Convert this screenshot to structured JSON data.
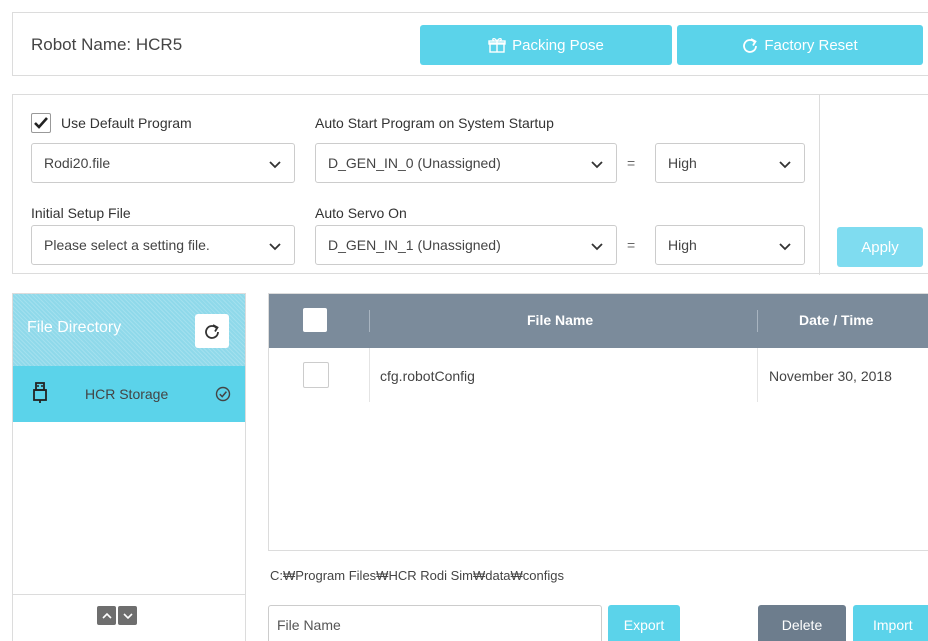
{
  "header": {
    "robot_name_label": "Robot Name: HCR5",
    "packing_pose_label": "Packing Pose",
    "factory_reset_label": "Factory Reset"
  },
  "settings": {
    "use_default_program_label": "Use Default Program",
    "use_default_program_checked": true,
    "default_program_value": "Rodi20.file",
    "initial_setup_label": "Initial Setup File",
    "initial_setup_placeholder": "Please select a setting file.",
    "auto_start_label": "Auto Start Program on System Startup",
    "auto_start_input_value": "D_GEN_IN_0 (Unassigned)",
    "auto_start_level_value": "High",
    "auto_servo_label": "Auto Servo On",
    "auto_servo_input_value": "D_GEN_IN_1 (Unassigned)",
    "auto_servo_level_value": "High",
    "equals_sign": "=",
    "apply_label": "Apply"
  },
  "file_directory": {
    "title": "File Directory",
    "items": [
      {
        "label": "HCR Storage",
        "selected": true
      }
    ]
  },
  "file_table": {
    "columns": [
      "File Name",
      "Date / Time"
    ],
    "rows": [
      {
        "name": "cfg.robotConfig",
        "date": "November 30, 2018"
      }
    ]
  },
  "path": "C:₩Program Files₩HCR Rodi Sim₩data₩configs",
  "actions": {
    "file_name_placeholder": "File Name",
    "export_label": "Export",
    "delete_label": "Delete",
    "import_label": "Import"
  },
  "colors": {
    "accent": "#5bd3ea",
    "table_header": "#7b8b9b",
    "delete": "#6d7d8d"
  }
}
